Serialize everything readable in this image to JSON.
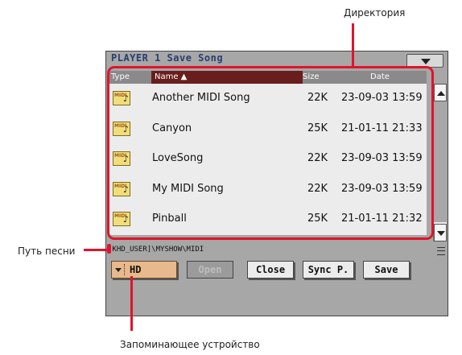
{
  "annotations": {
    "directory": "Директория",
    "song_path": "Путь песни",
    "storage_device": "Запоминающее устройство"
  },
  "window": {
    "title": "PLAYER 1  Save Song"
  },
  "columns": {
    "type": "Type",
    "name": "Name ▲",
    "size": "Size",
    "date": "Date"
  },
  "files": [
    {
      "icon": "midi-file-icon",
      "badge": "MIDI",
      "name": "Another MIDI Song",
      "size": "22K",
      "date": "23-09-03 13:59"
    },
    {
      "icon": "midi-file-icon",
      "badge": "MIDI",
      "name": "Canyon",
      "size": "25K",
      "date": "21-01-11 21:33"
    },
    {
      "icon": "midi-file-icon",
      "badge": "MIDI",
      "name": "LoveSong",
      "size": "22K",
      "date": "23-09-03 13:59"
    },
    {
      "icon": "midi-file-icon",
      "badge": "MIDI",
      "name": "My MIDI Song",
      "size": "22K",
      "date": "23-09-03 13:59"
    },
    {
      "icon": "midi-file-icon",
      "badge": "MIDI",
      "name": "Pinball",
      "size": "25K",
      "date": "21-01-11 21:32"
    }
  ],
  "path": "[KHD_USER]\\MYSHOW\\MIDI",
  "device": "HD",
  "buttons": {
    "open": "Open",
    "close": "Close",
    "sync": "Sync P.",
    "save": "Save"
  },
  "colors": {
    "highlight": "#e0142b",
    "name_header": "#6a1d1d",
    "title_text": "#2a3e70",
    "device_button": "#e8b98c"
  }
}
